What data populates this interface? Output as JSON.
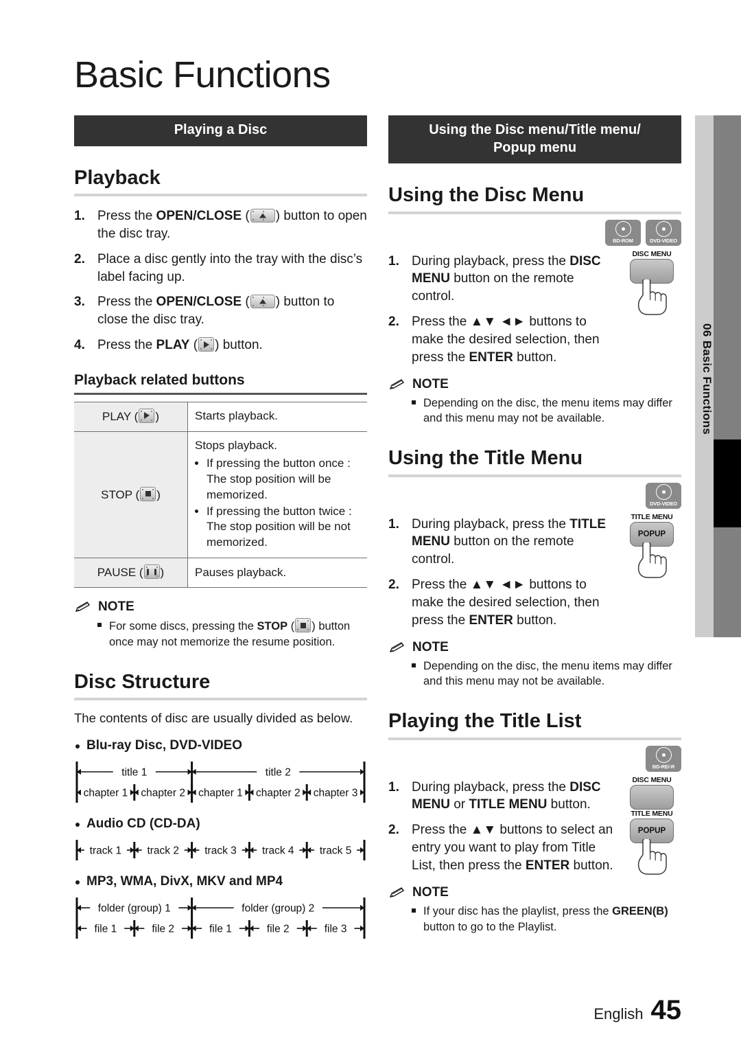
{
  "page": {
    "chapter_number": "06",
    "chapter_name": "Basic Functions",
    "masthead": "Basic Functions",
    "sidebar_tab": "06  Basic Functions",
    "footer_language": "English",
    "footer_page": "45"
  },
  "left": {
    "banner": "Playing a Disc",
    "playback_heading": "Playback",
    "steps": [
      {
        "num": "1.",
        "html": "Press the <b>OPEN/CLOSE</b> (<span class=\"glyph dots\" data-name=\"open-close-glyph\"><i class=\"ej\"></i></span>) button to open the disc tray."
      },
      {
        "num": "2.",
        "html": "Place a disc gently into the tray with the disc’s label facing up."
      },
      {
        "num": "3.",
        "html": "Press the <b>OPEN/CLOSE</b> (<span class=\"glyph dots\" data-name=\"open-close-glyph\"><i class=\"ej\"></i></span>) button to close the disc tray."
      },
      {
        "num": "4.",
        "html": "Press the <b>PLAY</b> (<span class=\"glyph sq dots\" data-name=\"play-glyph\"><i class=\"pl\"></i></span>) button."
      }
    ],
    "table_heading": "Playback related buttons",
    "table_rows": [
      {
        "key_text": "PLAY (",
        "key_icon": "play-glyph",
        "key_tail": ")",
        "desc": "Starts playback.",
        "bullets": []
      },
      {
        "key_text": "STOP (",
        "key_icon": "stop-glyph",
        "key_tail": ")",
        "desc": "Stops playback.",
        "bullets": [
          "If pressing the button once : The stop position will be memorized.",
          "If pressing the button twice : The stop position will be not memorized."
        ]
      },
      {
        "key_text": "PAUSE (",
        "key_icon": "pause-glyph",
        "key_tail": ")",
        "desc": "Pauses playback.",
        "bullets": []
      }
    ],
    "note_label": "NOTE",
    "note_html": "For some discs, pressing the <b>STOP</b> (<span class=\"glyph sq dots\" data-name=\"stop-glyph\"><i class=\"st\"></i></span>) button once may not memorize the resume position.",
    "disc_structure_heading": "Disc Structure",
    "disc_structure_lead": "The contents of disc are usually divided as below.",
    "groups": [
      {
        "label": "Blu-ray Disc, DVD-VIDEO",
        "rows": [
          {
            "cells": [
              "title 1",
              "title 2"
            ],
            "weights": [
              2,
              3
            ]
          },
          {
            "cells": [
              "chapter 1",
              "chapter 2",
              "chapter 1",
              "chapter 2",
              "chapter 3"
            ],
            "weights": [
              1,
              1,
              1,
              1,
              1
            ]
          }
        ]
      },
      {
        "label": "Audio CD (CD-DA)",
        "rows": [
          {
            "cells": [
              "track 1",
              "track 2",
              "track 3",
              "track 4",
              "track 5"
            ],
            "weights": [
              1,
              1,
              1,
              1,
              1
            ]
          }
        ]
      },
      {
        "label": "MP3, WMA, DivX, MKV and MP4",
        "rows": [
          {
            "cells": [
              "folder (group) 1",
              "folder (group) 2"
            ],
            "weights": [
              2,
              3
            ]
          },
          {
            "cells": [
              "file 1",
              "file 2",
              "file 1",
              "file 2",
              "file 3"
            ],
            "weights": [
              1,
              1,
              1,
              1,
              1
            ]
          }
        ]
      }
    ]
  },
  "right": {
    "banner_line1": "Using the Disc menu/Title menu/",
    "banner_line2": "Popup menu",
    "sections": [
      {
        "heading": "Using the Disc Menu",
        "badges": [
          "BD-ROM",
          "DVD-VIDEO"
        ],
        "steps": [
          {
            "num": "1.",
            "html": "During playback, press the <b>DISC MENU</b> button on the remote control."
          },
          {
            "num": "2.",
            "html": "Press the ▲▼ ◄► buttons to make the desired selection, then press the <b>ENTER</b> button."
          }
        ],
        "note_label": "NOTE",
        "note_html": "Depending on the disc, the menu items may differ and this menu may not be available.",
        "keys": [
          {
            "label": "DISC MENU",
            "face": ""
          }
        ]
      },
      {
        "heading": "Using the Title Menu",
        "badges": [
          "DVD-VIDEO"
        ],
        "steps": [
          {
            "num": "1.",
            "html": "During playback, press the <b>TITLE MENU</b> button on the remote control."
          },
          {
            "num": "2.",
            "html": "Press the ▲▼ ◄► buttons to make the desired selection, then press the <b>ENTER</b> button."
          }
        ],
        "note_label": "NOTE",
        "note_html": "Depending on the disc, the menu items may differ and this menu may not be available.",
        "keys": [
          {
            "label": "TITLE MENU",
            "face": "POPUP"
          }
        ]
      },
      {
        "heading": "Playing the Title List",
        "badges": [
          "BD-RE/-R"
        ],
        "steps": [
          {
            "num": "1.",
            "html": "During playback, press the <b>DISC MENU</b> or <b>TITLE MENU</b> button."
          },
          {
            "num": "2.",
            "html": "Press the ▲▼ buttons to select an entry you want to play from Title List, then press the <b>ENTER</b> button."
          }
        ],
        "note_label": "NOTE",
        "note_html": "If your disc has the playlist, press the <b>GREEN(B)</b> button to go to the Playlist.",
        "keys": [
          {
            "label": "DISC MENU",
            "face": ""
          },
          {
            "label": "TITLE MENU",
            "face": "POPUP"
          }
        ]
      }
    ]
  },
  "colors": {
    "banner_bg": "#333333",
    "rule": "#d4d4d4",
    "table_key_bg": "#ededed",
    "badge_bg": "#8a8a8a",
    "tab_light": "#cccccc",
    "tab_dark": "#808080"
  }
}
